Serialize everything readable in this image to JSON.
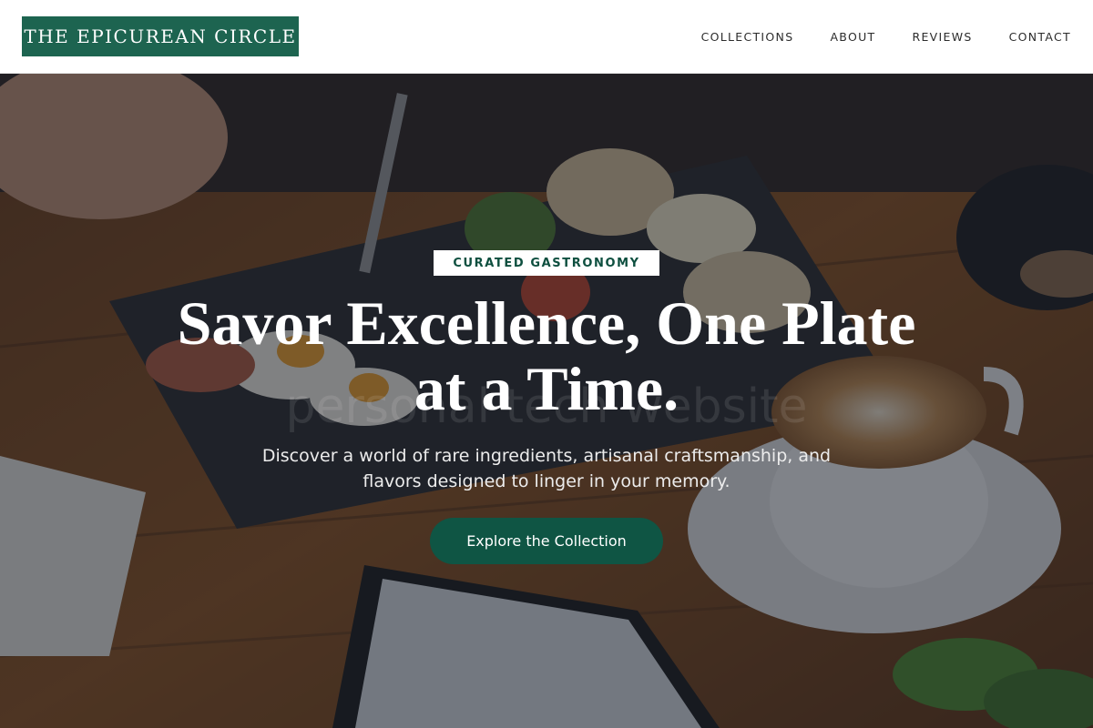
{
  "header": {
    "logo": "THE EPICUREAN CIRCLE",
    "nav": [
      "COLLECTIONS",
      "ABOUT",
      "REVIEWS",
      "CONTACT"
    ]
  },
  "hero": {
    "badge": "CURATED GASTRONOMY",
    "title_line1": "Savor Excellence, One Plate",
    "title_line2": "at a Time.",
    "subtitle_line1": "Discover a world of rare ingredients, artisanal craftsmanship, and",
    "subtitle_line2": "flavors designed to linger in your memory.",
    "cta": "Explore the Collection",
    "watermark": "personal tech website",
    "background": "hero-food-photo"
  },
  "colors": {
    "brand": "#1d6450",
    "cta": "#0f5544",
    "badge_text": "#0e4f3f",
    "overlay": "#161a26"
  }
}
